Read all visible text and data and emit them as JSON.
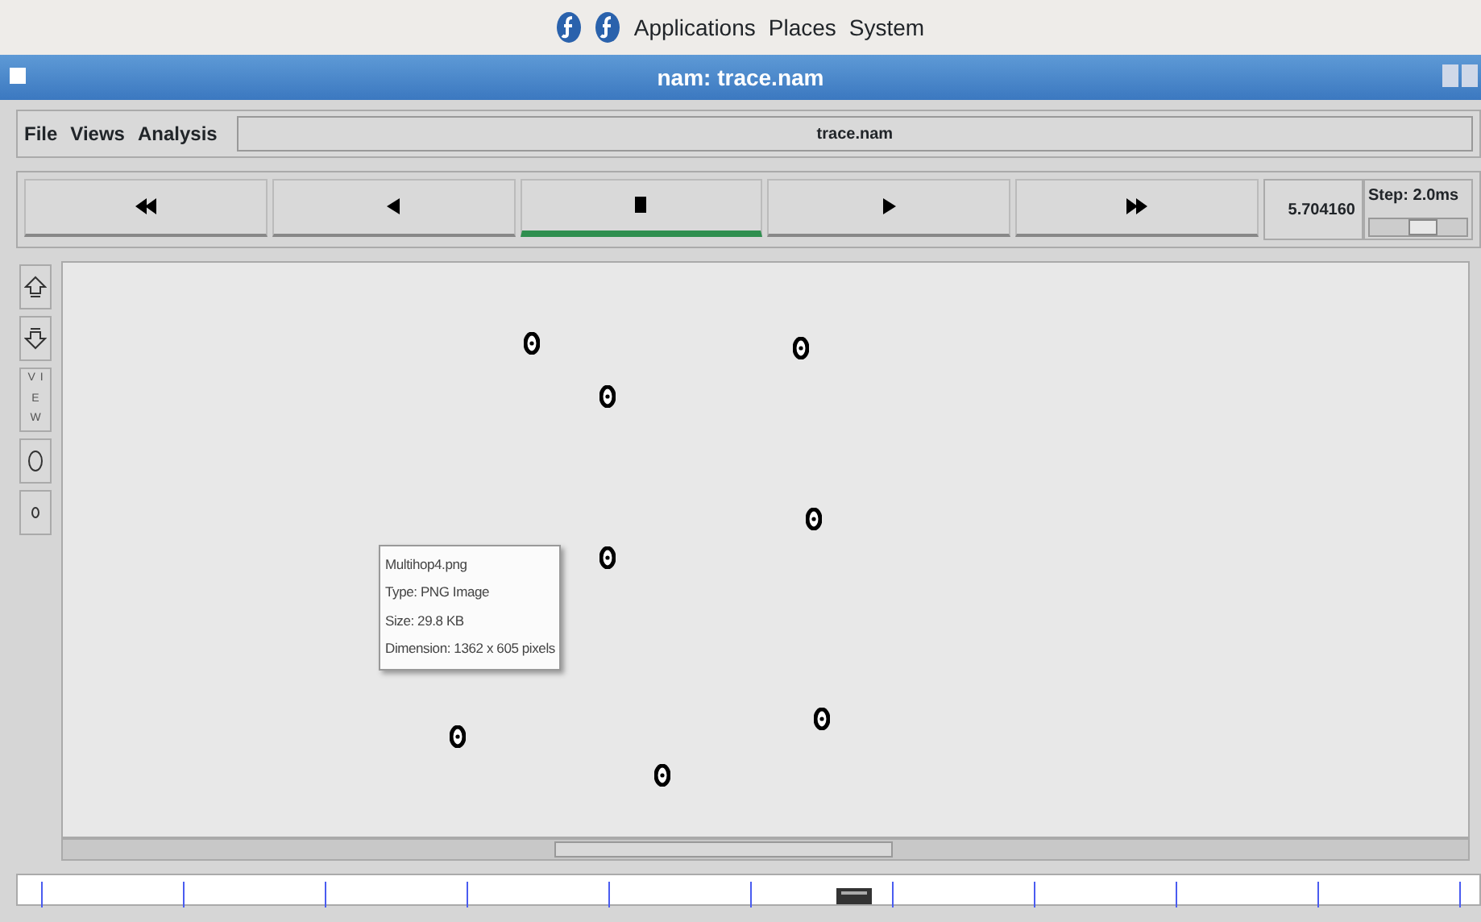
{
  "top_panel": {
    "menus": [
      "Applications",
      "Places",
      "System"
    ]
  },
  "window": {
    "title": "nam: trace.nam"
  },
  "menu": [
    "File",
    "Views",
    "Analysis"
  ],
  "file_label": "trace.nam",
  "transport": [
    {
      "kind": "rewind",
      "selected": false
    },
    {
      "kind": "back",
      "selected": false
    },
    {
      "kind": "stop",
      "selected": true
    },
    {
      "kind": "play",
      "selected": false
    },
    {
      "kind": "forward",
      "selected": false
    }
  ],
  "time": "5.704160",
  "step": {
    "label": "Step: 2.0ms",
    "level": 0.55
  },
  "side_tools": [
    {
      "kind": "zoom-in"
    },
    {
      "kind": "zoom-out"
    },
    {
      "kind": "text",
      "label": "VIEW"
    },
    {
      "kind": "big-circle"
    },
    {
      "kind": "small-circle"
    }
  ],
  "tooltip": [
    "Multihop4.png",
    "Type: PNG Image",
    "Size: 29.8 KB",
    "Dimension: 1362 x 605 pixels"
  ]
}
